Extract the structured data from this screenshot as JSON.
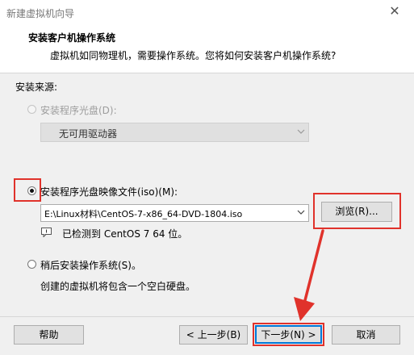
{
  "window": {
    "title": "新建虚拟机向导",
    "close_glyph": "✕"
  },
  "header": {
    "title": "安装客户机操作系统",
    "subtitle": "虚拟机如同物理机，需要操作系统。您将如何安装客户机操作系统?"
  },
  "source_label": "安装来源:",
  "option_disc": {
    "label": "安装程序光盘(D):",
    "selected": false,
    "enabled": false
  },
  "drive_select": {
    "value": "无可用驱动器",
    "enabled": false
  },
  "option_iso": {
    "label": "安装程序光盘映像文件(iso)(M):",
    "selected": true
  },
  "iso_path": {
    "value": "E:\\Linux材料\\CentOS-7-x86_64-DVD-1804.iso"
  },
  "browse_button": "浏览(R)...",
  "detect_message": "已检测到 CentOS 7 64 位。",
  "option_later": {
    "label": "稍后安装操作系统(S)。",
    "selected": false
  },
  "later_description": "创建的虚拟机将包含一个空白硬盘。",
  "footer": {
    "help": "帮助",
    "back": "< 上一步(B)",
    "next": "下一步(N) >",
    "cancel": "取消"
  },
  "colors": {
    "annotation": "#e0322b",
    "focus": "#0078d7"
  },
  "icons": {
    "dropdown": "chevron-down-icon",
    "info": "info-icon",
    "close": "close-icon"
  }
}
